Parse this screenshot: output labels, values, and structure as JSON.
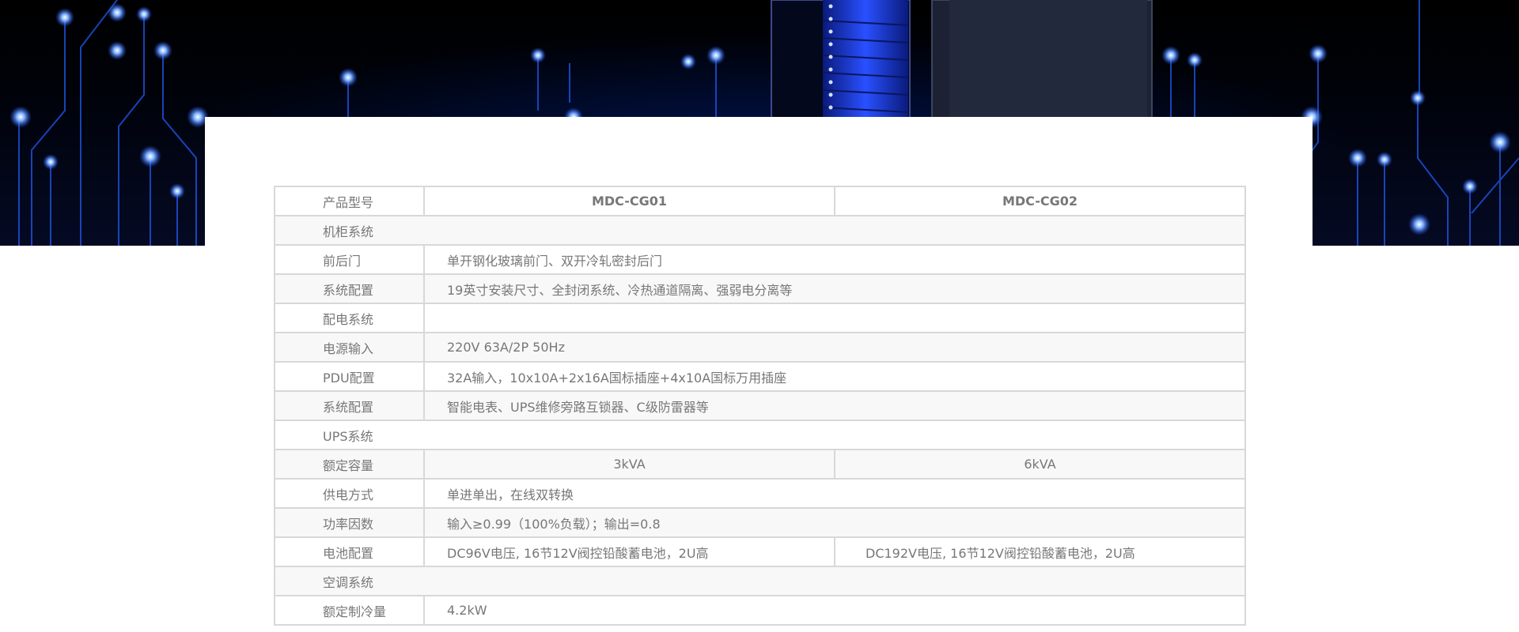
{
  "colors": {
    "table_border": "#d8d8d8",
    "alt_row": "#f8f8f8",
    "text": "#777777",
    "hero_glow": "#1a4dff"
  },
  "table": {
    "header": {
      "label": "产品型号",
      "models": [
        "MDC-CG01",
        "MDC-CG02"
      ]
    },
    "rows": [
      {
        "label": "机柜系统"
      },
      {
        "label": "前后门",
        "value": "单开钢化玻璃前门、双开冷轧密封后门"
      },
      {
        "label": "系统配置",
        "value": "19英寸安装尺寸、全封闭系统、冷热通道隔离、强弱电分离等"
      },
      {
        "label": "配电系统"
      },
      {
        "label": "电源输入",
        "value": "220V 63A/2P 50Hz"
      },
      {
        "label": "PDU配置",
        "value": "32A输入，10x10A+2x16A国标插座+4x10A国标万用插座"
      },
      {
        "label": "系统配置",
        "value": "智能电表、UPS维修旁路互锁器、C级防雷器等"
      },
      {
        "label": "UPS系统"
      },
      {
        "label": "额定容量",
        "values": [
          "3kVA",
          "6kVA"
        ]
      },
      {
        "label": "供电方式",
        "value": "单进单出，在线双转换"
      },
      {
        "label": "功率因数",
        "value": "输入≥0.99（100%负载）；输出=0.8"
      },
      {
        "label": "电池配置",
        "values": [
          "DC96V电压, 16节12V阀控铅酸蓄电池，2U高",
          "DC192V电压, 16节12V阀控铅酸蓄电池，2U高"
        ]
      },
      {
        "label": "空调系统"
      },
      {
        "label": "额定制冷量",
        "value": "4.2kW"
      }
    ]
  }
}
